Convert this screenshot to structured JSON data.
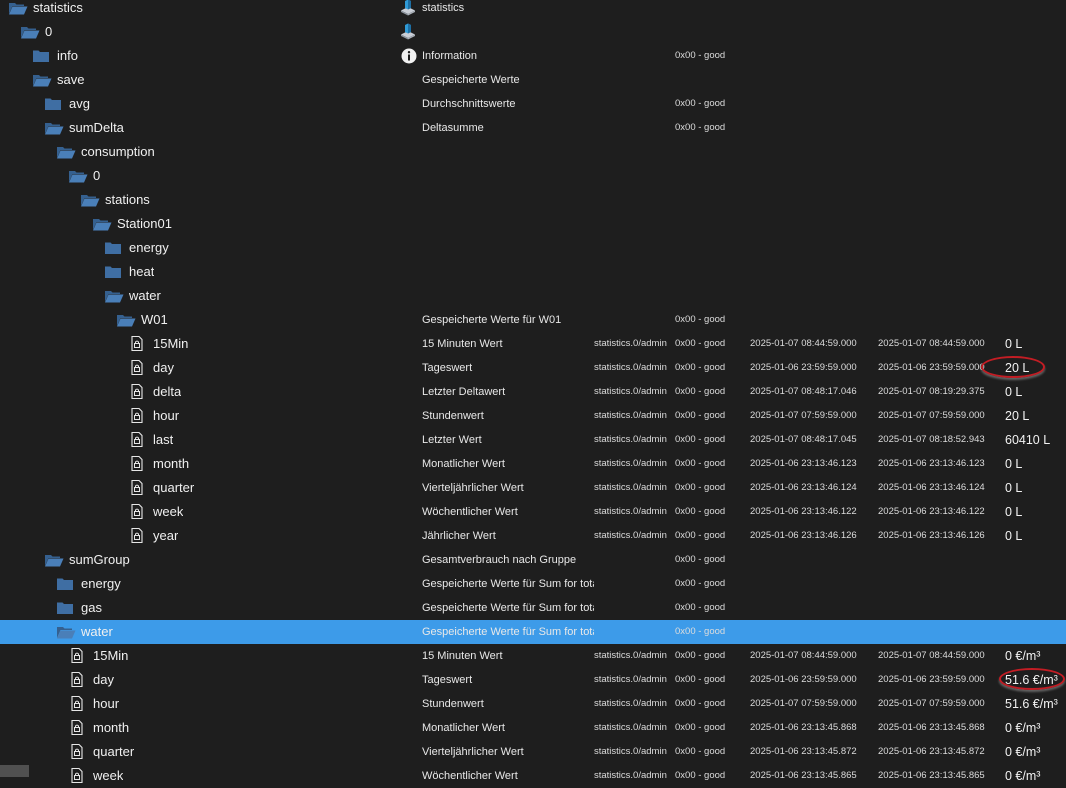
{
  "rows": [
    {
      "name": "statistics",
      "depth": 0,
      "icon": "folder-open-icon",
      "desc": "statistics",
      "descIcon": "adapter-logo-icon"
    },
    {
      "name": "0",
      "depth": 1,
      "icon": "folder-open-icon",
      "desc": "",
      "descIcon": "adapter-logo-icon"
    },
    {
      "name": "info",
      "depth": 2,
      "icon": "folder-icon",
      "desc": "Information",
      "descIcon": "info-icon",
      "ack": "0x00 - good"
    },
    {
      "name": "save",
      "depth": 2,
      "icon": "folder-open-icon",
      "desc": "Gespeicherte Werte"
    },
    {
      "name": "avg",
      "depth": 3,
      "icon": "folder-icon",
      "desc": "Durchschnittswerte",
      "ack": "0x00 - good"
    },
    {
      "name": "sumDelta",
      "depth": 3,
      "icon": "folder-open-icon",
      "desc": "Deltasumme",
      "ack": "0x00 - good"
    },
    {
      "name": "consumption",
      "depth": 4,
      "icon": "folder-open-icon"
    },
    {
      "name": "0",
      "depth": 5,
      "icon": "folder-open-icon"
    },
    {
      "name": "stations",
      "depth": 6,
      "icon": "folder-open-icon"
    },
    {
      "name": "Station01",
      "depth": 7,
      "icon": "folder-open-icon"
    },
    {
      "name": "energy",
      "depth": 8,
      "icon": "folder-icon"
    },
    {
      "name": "heat",
      "depth": 8,
      "icon": "folder-icon"
    },
    {
      "name": "water",
      "depth": 8,
      "icon": "folder-open-icon"
    },
    {
      "name": "W01",
      "depth": 9,
      "icon": "folder-open-icon",
      "desc": "Gespeicherte Werte für W01",
      "ack": "0x00 - good"
    },
    {
      "name": "15Min",
      "depth": 10,
      "icon": "file-icon",
      "desc": "15 Minuten Wert",
      "role": "statistics.0/admin",
      "ack": "0x00 - good",
      "ts": "2025-01-07 08:44:59.000",
      "lc": "2025-01-07 08:44:59.000",
      "val": "0 L"
    },
    {
      "name": "day",
      "depth": 10,
      "icon": "file-icon",
      "desc": "Tageswert",
      "role": "statistics.0/admin",
      "ack": "0x00 - good",
      "ts": "2025-01-06 23:59:59.000",
      "lc": "2025-01-06 23:59:59.000",
      "val": "20 L",
      "circled": true
    },
    {
      "name": "delta",
      "depth": 10,
      "icon": "file-icon",
      "desc": "Letzter Deltawert",
      "role": "statistics.0/admin",
      "ack": "0x00 - good",
      "ts": "2025-01-07 08:48:17.046",
      "lc": "2025-01-07 08:19:29.375",
      "val": "0 L"
    },
    {
      "name": "hour",
      "depth": 10,
      "icon": "file-icon",
      "desc": "Stundenwert",
      "role": "statistics.0/admin",
      "ack": "0x00 - good",
      "ts": "2025-01-07 07:59:59.000",
      "lc": "2025-01-07 07:59:59.000",
      "val": "20 L"
    },
    {
      "name": "last",
      "depth": 10,
      "icon": "file-icon",
      "desc": "Letzter Wert",
      "role": "statistics.0/admin",
      "ack": "0x00 - good",
      "ts": "2025-01-07 08:48:17.045",
      "lc": "2025-01-07 08:18:52.943",
      "val": "60410 L"
    },
    {
      "name": "month",
      "depth": 10,
      "icon": "file-icon",
      "desc": "Monatlicher Wert",
      "role": "statistics.0/admin",
      "ack": "0x00 - good",
      "ts": "2025-01-06 23:13:46.123",
      "lc": "2025-01-06 23:13:46.123",
      "val": "0 L"
    },
    {
      "name": "quarter",
      "depth": 10,
      "icon": "file-icon",
      "desc": "Vierteljährlicher Wert",
      "role": "statistics.0/admin",
      "ack": "0x00 - good",
      "ts": "2025-01-06 23:13:46.124",
      "lc": "2025-01-06 23:13:46.124",
      "val": "0 L"
    },
    {
      "name": "week",
      "depth": 10,
      "icon": "file-icon",
      "desc": "Wöchentlicher Wert",
      "role": "statistics.0/admin",
      "ack": "0x00 - good",
      "ts": "2025-01-06 23:13:46.122",
      "lc": "2025-01-06 23:13:46.122",
      "val": "0 L"
    },
    {
      "name": "year",
      "depth": 10,
      "icon": "file-icon",
      "desc": "Jährlicher Wert",
      "role": "statistics.0/admin",
      "ack": "0x00 - good",
      "ts": "2025-01-06 23:13:46.126",
      "lc": "2025-01-06 23:13:46.126",
      "val": "0 L"
    },
    {
      "name": "sumGroup",
      "depth": 3,
      "icon": "folder-open-icon",
      "desc": "Gesamtverbrauch nach Gruppe",
      "ack": "0x00 - good"
    },
    {
      "name": "energy",
      "depth": 4,
      "icon": "folder-icon",
      "desc": "Gespeicherte Werte für Sum for total energy",
      "ack": "0x00 - good"
    },
    {
      "name": "gas",
      "depth": 4,
      "icon": "folder-icon",
      "desc": "Gespeicherte Werte für Sum for total gas",
      "ack": "0x00 - good"
    },
    {
      "name": "water",
      "depth": 4,
      "icon": "folder-open-icon",
      "desc": "Gespeicherte Werte für Sum for total water",
      "ack": "0x00 - good",
      "selected": true
    },
    {
      "name": "15Min",
      "depth": 5,
      "icon": "file-icon",
      "desc": "15 Minuten Wert",
      "role": "statistics.0/admin",
      "ack": "0x00 - good",
      "ts": "2025-01-07 08:44:59.000",
      "lc": "2025-01-07 08:44:59.000",
      "val": "0 €/m³"
    },
    {
      "name": "day",
      "depth": 5,
      "icon": "file-icon",
      "desc": "Tageswert",
      "role": "statistics.0/admin",
      "ack": "0x00 - good",
      "ts": "2025-01-06 23:59:59.000",
      "lc": "2025-01-06 23:59:59.000",
      "val": "51.6 €/m³",
      "circled": true
    },
    {
      "name": "hour",
      "depth": 5,
      "icon": "file-icon",
      "desc": "Stundenwert",
      "role": "statistics.0/admin",
      "ack": "0x00 - good",
      "ts": "2025-01-07 07:59:59.000",
      "lc": "2025-01-07 07:59:59.000",
      "val": "51.6 €/m³"
    },
    {
      "name": "month",
      "depth": 5,
      "icon": "file-icon",
      "desc": "Monatlicher Wert",
      "role": "statistics.0/admin",
      "ack": "0x00 - good",
      "ts": "2025-01-06 23:13:45.868",
      "lc": "2025-01-06 23:13:45.868",
      "val": "0 €/m³"
    },
    {
      "name": "quarter",
      "depth": 5,
      "icon": "file-icon",
      "desc": "Vierteljährlicher Wert",
      "role": "statistics.0/admin",
      "ack": "0x00 - good",
      "ts": "2025-01-06 23:13:45.872",
      "lc": "2025-01-06 23:13:45.872",
      "val": "0 €/m³"
    },
    {
      "name": "week",
      "depth": 5,
      "icon": "file-icon",
      "desc": "Wöchentlicher Wert",
      "role": "statistics.0/admin",
      "ack": "0x00 - good",
      "ts": "2025-01-06 23:13:45.865",
      "lc": "2025-01-06 23:13:45.865",
      "val": "0 €/m³"
    }
  ],
  "colors": {
    "background": "#1e1e1e",
    "selected": "#3d9be9",
    "folder": "#3f6ea3",
    "annotation": "#c31d24"
  }
}
